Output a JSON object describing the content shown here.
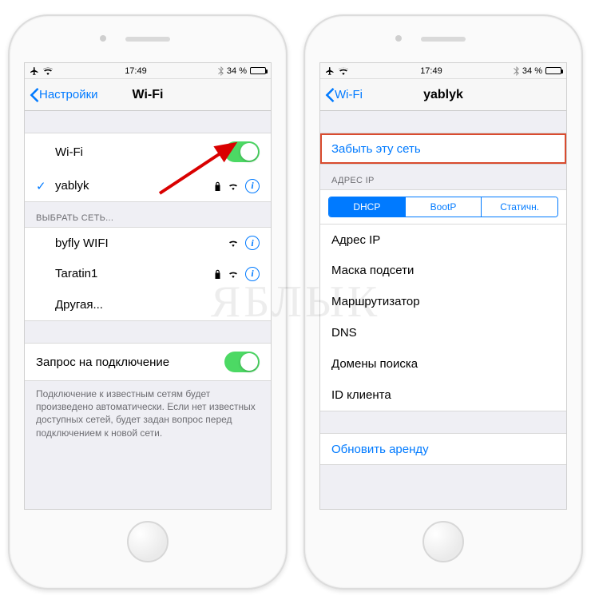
{
  "status": {
    "time": "17:49",
    "battery_pct": "34 %"
  },
  "phone1": {
    "back": "Настройки",
    "title": "Wi-Fi",
    "wifi_label": "Wi-Fi",
    "connected_network": "yablyk",
    "choose_header": "ВЫБРАТЬ СЕТЬ...",
    "networks": [
      {
        "name": "byfly WIFI",
        "locked": false
      },
      {
        "name": "Taratin1",
        "locked": true
      }
    ],
    "other": "Другая...",
    "ask_label": "Запрос на подключение",
    "ask_footer": "Подключение к известным сетям будет произведено автоматически. Если нет известных доступных сетей, будет задан вопрос перед подключением к новой сети."
  },
  "phone2": {
    "back": "Wi-Fi",
    "title": "yablyk",
    "forget": "Забыть эту сеть",
    "ip_header": "АДРЕС IP",
    "seg": {
      "dhcp": "DHCP",
      "bootp": "BootP",
      "static": "Статичн."
    },
    "rows": {
      "ip": "Адрес IP",
      "mask": "Маска подсети",
      "router": "Маршрутизатор",
      "dns": "DNS",
      "search": "Домены поиска",
      "client": "ID клиента"
    },
    "renew": "Обновить аренду"
  },
  "watermark": "ЯБЛЫК"
}
